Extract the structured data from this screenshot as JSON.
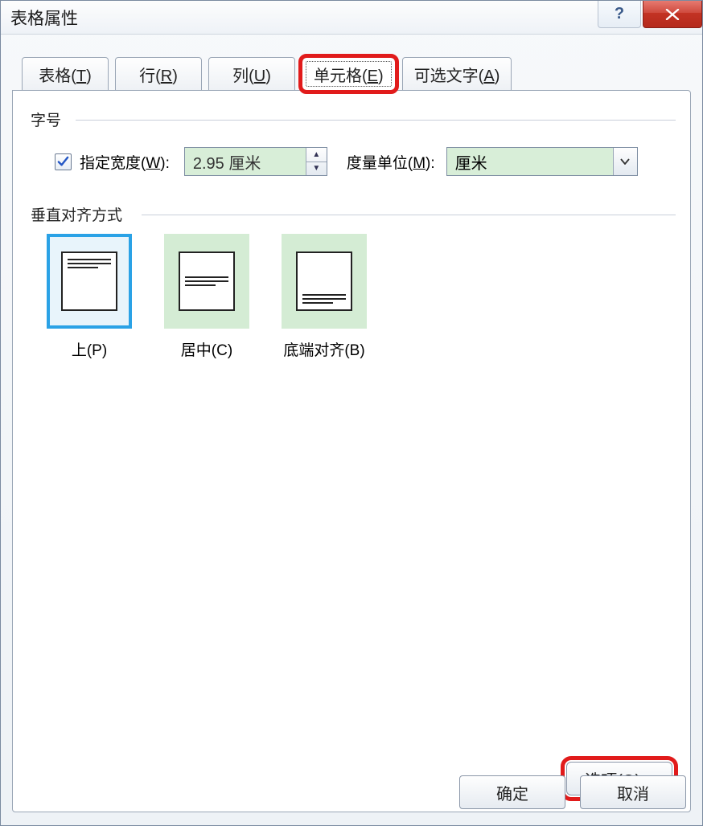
{
  "window": {
    "title": "表格属性"
  },
  "tabs": {
    "table": {
      "pre": "表格(",
      "key": "T",
      "post": ")"
    },
    "row": {
      "pre": "行(",
      "key": "R",
      "post": ")"
    },
    "column": {
      "pre": "列(",
      "key": "U",
      "post": ")"
    },
    "cell": {
      "pre": "单元格(",
      "key": "E",
      "post": ")"
    },
    "alttext": {
      "pre": "可选文字(",
      "key": "A",
      "post": ")"
    }
  },
  "groups": {
    "size": "字号",
    "valign": "垂直对齐方式"
  },
  "size": {
    "specify_pre": "指定宽度(",
    "specify_key": "W",
    "specify_post": "):",
    "width_value": "2.95 厘米",
    "unit_label_pre": "度量单位(",
    "unit_label_key": "M",
    "unit_label_post": "):",
    "unit_value": "厘米"
  },
  "valign": {
    "top": {
      "pre": "上(",
      "key": "P",
      "post": ")"
    },
    "center": {
      "pre": "居中(",
      "key": "C",
      "post": ")"
    },
    "bottom": {
      "pre": "底端对齐(",
      "key": "B",
      "post": ")"
    }
  },
  "buttons": {
    "options_pre": "选项(",
    "options_key": "O",
    "options_post": ")...",
    "ok": "确定",
    "cancel": "取消"
  }
}
